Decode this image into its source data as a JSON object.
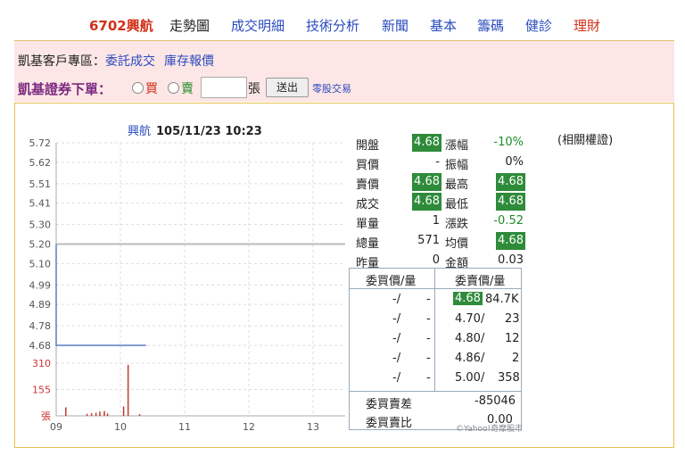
{
  "nav": {
    "stock": "6702興航",
    "items": [
      "走勢圖",
      "成交明細",
      "技術分析",
      "新聞",
      "基本",
      "籌碼",
      "健診",
      "理財"
    ]
  },
  "breadcrumb": {
    "prefix": "凱基客戶專區：",
    "link1": "委託成交",
    "link2": "庫存報價"
  },
  "order": {
    "title": "凱基證券下單：",
    "buy_label": "買",
    "sell_label": "賣",
    "qty_value": "",
    "unit": "張",
    "send_label": "送出",
    "oddlot_label": "零股交易"
  },
  "chart_header": {
    "name": "興航",
    "datetime": "105/11/23 10:23"
  },
  "related": "(相關權證)",
  "quote": {
    "open_label": "開盤",
    "open": "4.68",
    "chg_pct_label": "漲幅",
    "chg_pct": "-10%",
    "bid_label": "買價",
    "bid": "-",
    "amp_label": "振幅",
    "amp": "0%",
    "ask_label": "賣價",
    "ask": "4.68",
    "high_label": "最高",
    "high": "4.68",
    "last_label": "成交",
    "last": "4.68",
    "low_label": "最低",
    "low": "4.68",
    "tickvol_label": "單量",
    "tickvol": "1",
    "change_label": "漲跌",
    "change": "-0.52",
    "volume_label": "總量",
    "volume": "571",
    "avg_label": "均價",
    "avg": "4.68",
    "prevvol_label": "昨量",
    "prevvol": "0",
    "amount_label": "金額",
    "amount": "0.03"
  },
  "order_book": {
    "bid_header": "委買價/量",
    "ask_header": "委賣價/量",
    "rows": [
      {
        "bid_price": "-/",
        "bid_vol": "-",
        "ask_price": "4.68",
        "ask_vol": "84.7K"
      },
      {
        "bid_price": "-/",
        "bid_vol": "-",
        "ask_price": "4.70/",
        "ask_vol": "23"
      },
      {
        "bid_price": "-/",
        "bid_vol": "-",
        "ask_price": "4.80/",
        "ask_vol": "12"
      },
      {
        "bid_price": "-/",
        "bid_vol": "-",
        "ask_price": "4.86/",
        "ask_vol": "2"
      },
      {
        "bid_price": "-/",
        "bid_vol": "-",
        "ask_price": "5.00/",
        "ask_vol": "358"
      }
    ],
    "diff_label": "委買賣差",
    "diff": "-85046",
    "ratio_label": "委買賣比",
    "ratio": "0.00"
  },
  "copyright": "©Yahoo!奇摩股市",
  "colors": {
    "accent_green": "#2e8b3a",
    "link_blue": "#2a4bbd",
    "down_green": "#1e8c2a",
    "stock_red": "#d03018"
  },
  "chart_data": {
    "type": "line",
    "title": "興航 105/11/23 10:23",
    "price_ticks": [
      "5.72",
      "5.62",
      "5.51",
      "5.41",
      "5.30",
      "5.20",
      "5.10",
      "4.99",
      "4.89",
      "4.78",
      "4.68"
    ],
    "price_range": [
      4.68,
      5.72
    ],
    "reference_price": 5.2,
    "x_ticks": [
      "09",
      "10",
      "11",
      "12",
      "13"
    ],
    "x_range_hours": [
      9,
      13.5
    ],
    "series": [
      {
        "values_x_hours": [
          9.0,
          9.0,
          10.4
        ],
        "values_price": [
          5.2,
          4.68,
          4.68
        ]
      }
    ],
    "volume_ticks": [
      "310",
      "155",
      "張"
    ],
    "volume_range": [
      0,
      310
    ],
    "volume_bars": [
      {
        "x": 9.15,
        "v": 50
      },
      {
        "x": 9.48,
        "v": 12
      },
      {
        "x": 9.55,
        "v": 15
      },
      {
        "x": 9.62,
        "v": 18
      },
      {
        "x": 9.68,
        "v": 25
      },
      {
        "x": 9.75,
        "v": 28
      },
      {
        "x": 9.8,
        "v": 14
      },
      {
        "x": 10.05,
        "v": 55
      },
      {
        "x": 10.12,
        "v": 300
      },
      {
        "x": 10.3,
        "v": 10
      }
    ],
    "grid": true
  }
}
